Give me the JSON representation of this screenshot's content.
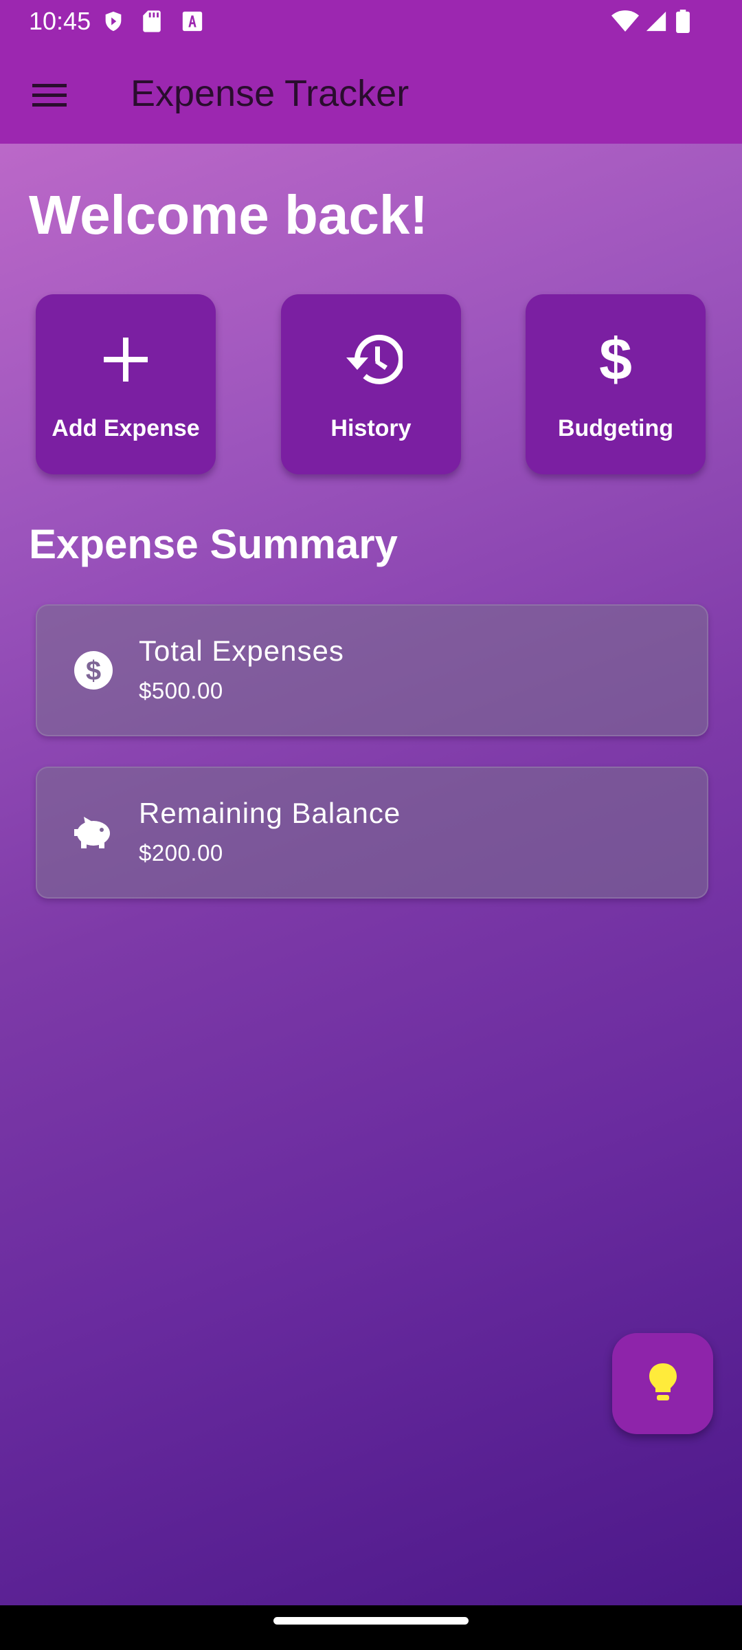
{
  "status_bar": {
    "time": "10:45"
  },
  "app_bar": {
    "title": "Expense Tracker",
    "menu_icon": "hamburger-menu-icon"
  },
  "welcome": "Welcome back!",
  "actions": [
    {
      "label": "Add Expense",
      "icon": "plus-icon"
    },
    {
      "label": "History",
      "icon": "history-icon"
    },
    {
      "label": "Budgeting",
      "icon": "dollar-icon"
    }
  ],
  "summary": {
    "heading": "Expense Summary",
    "cards": [
      {
        "title": "Total Expenses",
        "value": "$500.00",
        "icon": "dollar-circle-icon"
      },
      {
        "title": "Remaining Balance",
        "value": "$200.00",
        "icon": "piggy-bank-icon"
      }
    ]
  },
  "fab": {
    "icon": "lightbulb-icon"
  },
  "colors": {
    "primary": "#9c27b0",
    "card": "#7b1fa2",
    "fab_icon": "#ffeb3b"
  }
}
